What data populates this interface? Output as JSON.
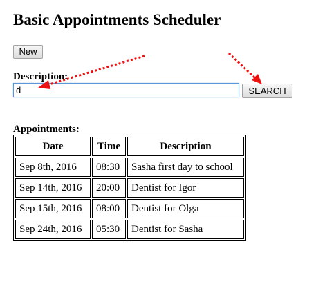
{
  "page": {
    "title": "Basic Appointments Scheduler"
  },
  "toolbar": {
    "new_label": "New"
  },
  "search": {
    "label": "Description:",
    "value": "d",
    "button_label": "SEARCH"
  },
  "appointments": {
    "caption": "Appointments:",
    "headers": [
      "Date",
      "Time",
      "Description"
    ],
    "rows": [
      {
        "date": "Sep 8th, 2016",
        "time": "08:30",
        "description": "Sasha first day to school"
      },
      {
        "date": "Sep 14th, 2016",
        "time": "20:00",
        "description": "Dentist for Igor"
      },
      {
        "date": "Sep 15th, 2016",
        "time": "08:00",
        "description": "Dentist for Olga"
      },
      {
        "date": "Sep 24th, 2016",
        "time": "05:30",
        "description": "Dentist for Sasha"
      }
    ]
  },
  "annotations": {
    "arrow_color": "#ee1111",
    "arrows": [
      {
        "icon": "dotted-arrow-icon",
        "points_to": "search-input"
      },
      {
        "icon": "dotted-arrow-icon",
        "points_to": "search-button"
      }
    ]
  }
}
